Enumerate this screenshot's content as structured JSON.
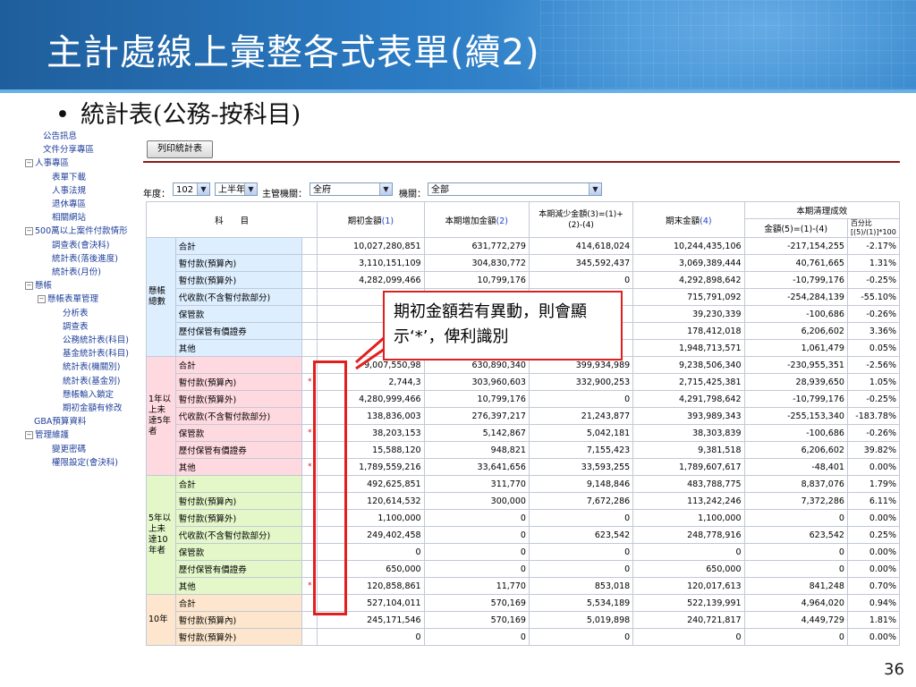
{
  "slide": {
    "title": "主計處線上彙整各式表單(續2)",
    "bullet": "統計表(公務-按科目)",
    "bullet_glyph": "•",
    "page_number": "36",
    "callout": "期初金額若有異動，則會顯示‘*’，俾利識別"
  },
  "sidebar": {
    "items": [
      {
        "label": "公告訊息",
        "toggle": ""
      },
      {
        "label": "文件分享專區",
        "toggle": ""
      },
      {
        "label": "人事專區",
        "toggle": "⊟"
      },
      {
        "label": "表單下載",
        "toggle": ""
      },
      {
        "label": "人事法規",
        "toggle": ""
      },
      {
        "label": "退休專區",
        "toggle": ""
      },
      {
        "label": "相關網站",
        "toggle": ""
      },
      {
        "label": "500萬以上案件付款情形",
        "toggle": "⊟"
      },
      {
        "label": "調查表(會決科)",
        "toggle": ""
      },
      {
        "label": "統計表(落後進度)",
        "toggle": ""
      },
      {
        "label": "統計表(月份)",
        "toggle": ""
      },
      {
        "label": "懸帳",
        "toggle": "⊟"
      },
      {
        "label": "懸帳表單管理",
        "toggle": "⊟"
      },
      {
        "label": "分析表",
        "toggle": ""
      },
      {
        "label": "調查表",
        "toggle": ""
      },
      {
        "label": "公務統計表(科目)",
        "toggle": ""
      },
      {
        "label": "基金統計表(科目)",
        "toggle": ""
      },
      {
        "label": "統計表(機關別)",
        "toggle": ""
      },
      {
        "label": "統計表(基金別)",
        "toggle": ""
      },
      {
        "label": "懸帳輸入鎖定",
        "toggle": ""
      },
      {
        "label": "期初金額有修改",
        "toggle": ""
      },
      {
        "label": "GBA預算資料",
        "toggle": ""
      },
      {
        "label": "管理維護",
        "toggle": "⊟"
      },
      {
        "label": "變更密碼",
        "toggle": ""
      },
      {
        "label": "權限設定(會決科)",
        "toggle": ""
      }
    ]
  },
  "toolbar": {
    "print_label": "列印統計表"
  },
  "filters": {
    "year_label": "年度：",
    "year_value": "102",
    "half_value": "上半年",
    "agency_label": "主管機關：",
    "agency_value": "全府",
    "org_label": "機關：",
    "org_value": "全部",
    "dropdown_glyph": "▼"
  },
  "table": {
    "headers": {
      "subject": "科　　目",
      "opening": "期初金額",
      "opening_num": "(1)",
      "increase": "本期增加金額",
      "increase_num": "(2)",
      "decrease": "本期減少金額(3)=(1)+(2)-(4)",
      "closing": "期末金額",
      "closing_num": "(4)",
      "clearing": "本期清理成效",
      "amount": "金額(5)=(1)-(4)",
      "percent": "百分比[(5)/(1)]*100"
    },
    "groups": [
      {
        "name": "懸帳總數",
        "rows": [
          {
            "item": "合計",
            "star": "",
            "opening": "10,027,280,851",
            "increase": "631,772,279",
            "decrease": "414,618,024",
            "closing": "10,244,435,106",
            "amount": "-217,154,255",
            "pct": "-2.17%"
          },
          {
            "item": "暫付款(預算內)",
            "star": "",
            "opening": "3,110,151,109",
            "increase": "304,830,772",
            "decrease": "345,592,437",
            "closing": "3,069,389,444",
            "amount": "40,761,665",
            "pct": "1.31%"
          },
          {
            "item": "暫付款(預算外)",
            "star": "",
            "opening": "4,282,099,466",
            "increase": "10,799,176",
            "decrease": "0",
            "closing": "4,292,898,642",
            "amount": "-10,799,176",
            "pct": "-0.25%"
          },
          {
            "item": "代收款(不含暫付款部分)",
            "star": "",
            "opening": "461,5",
            "increase": "",
            "decrease": "",
            "closing": "715,791,092",
            "amount": "-254,284,139",
            "pct": "-55.10%"
          },
          {
            "item": "保管款",
            "star": "",
            "opening": "39,1",
            "increase": "",
            "decrease": "",
            "closing": "39,230,339",
            "amount": "-100,686",
            "pct": "-0.26%"
          },
          {
            "item": "歷付保管有價證券",
            "star": "",
            "opening": "184,6",
            "increase": "",
            "decrease": "",
            "closing": "178,412,018",
            "amount": "6,206,602",
            "pct": "3.36%"
          },
          {
            "item": "其他",
            "star": "",
            "opening": "1,949,7",
            "increase": "",
            "decrease": "",
            "closing": "1,948,713,571",
            "amount": "1,061,479",
            "pct": "0.05%"
          }
        ]
      },
      {
        "name": "1年以上未達5年者",
        "rows": [
          {
            "item": "合計",
            "star": "",
            "opening": "9,007,550,98",
            "increase": "630,890,340",
            "decrease": "399,934,989",
            "closing": "9,238,506,340",
            "amount": "-230,955,351",
            "pct": "-2.56%"
          },
          {
            "item": "暫付款(預算內)",
            "star": "*",
            "opening": "2,744,3",
            "increase": "303,960,603",
            "decrease": "332,900,253",
            "closing": "2,715,425,381",
            "amount": "28,939,650",
            "pct": "1.05%"
          },
          {
            "item": "暫付款(預算外)",
            "star": "",
            "opening": "4,280,999,466",
            "increase": "10,799,176",
            "decrease": "0",
            "closing": "4,291,798,642",
            "amount": "-10,799,176",
            "pct": "-0.25%"
          },
          {
            "item": "代收款(不含暫付款部分)",
            "star": "",
            "opening": "138,836,003",
            "increase": "276,397,217",
            "decrease": "21,243,877",
            "closing": "393,989,343",
            "amount": "-255,153,340",
            "pct": "-183.78%"
          },
          {
            "item": "保管款",
            "star": "*",
            "opening": "38,203,153",
            "increase": "5,142,867",
            "decrease": "5,042,181",
            "closing": "38,303,839",
            "amount": "-100,686",
            "pct": "-0.26%"
          },
          {
            "item": "歷付保管有價證券",
            "star": "",
            "opening": "15,588,120",
            "increase": "948,821",
            "decrease": "7,155,423",
            "closing": "9,381,518",
            "amount": "6,206,602",
            "pct": "39.82%"
          },
          {
            "item": "其他",
            "star": "*",
            "opening": "1,789,559,216",
            "increase": "33,641,656",
            "decrease": "33,593,255",
            "closing": "1,789,607,617",
            "amount": "-48,401",
            "pct": "0.00%"
          }
        ]
      },
      {
        "name": "5年以上未達10年者",
        "rows": [
          {
            "item": "合計",
            "star": "",
            "opening": "492,625,851",
            "increase": "311,770",
            "decrease": "9,148,846",
            "closing": "483,788,775",
            "amount": "8,837,076",
            "pct": "1.79%"
          },
          {
            "item": "暫付款(預算內)",
            "star": "",
            "opening": "120,614,532",
            "increase": "300,000",
            "decrease": "7,672,286",
            "closing": "113,242,246",
            "amount": "7,372,286",
            "pct": "6.11%"
          },
          {
            "item": "暫付款(預算外)",
            "star": "",
            "opening": "1,100,000",
            "increase": "0",
            "decrease": "0",
            "closing": "1,100,000",
            "amount": "0",
            "pct": "0.00%"
          },
          {
            "item": "代收款(不含暫付款部分)",
            "star": "",
            "opening": "249,402,458",
            "increase": "0",
            "decrease": "623,542",
            "closing": "248,778,916",
            "amount": "623,542",
            "pct": "0.25%"
          },
          {
            "item": "保管款",
            "star": "",
            "opening": "0",
            "increase": "0",
            "decrease": "0",
            "closing": "0",
            "amount": "0",
            "pct": "0.00%"
          },
          {
            "item": "歷付保管有價證券",
            "star": "",
            "opening": "650,000",
            "increase": "0",
            "decrease": "0",
            "closing": "650,000",
            "amount": "0",
            "pct": "0.00%"
          },
          {
            "item": "其他",
            "star": "*",
            "opening": "120,858,861",
            "increase": "11,770",
            "decrease": "853,018",
            "closing": "120,017,613",
            "amount": "841,248",
            "pct": "0.70%"
          }
        ]
      },
      {
        "name": "10年",
        "rows": [
          {
            "item": "合計",
            "star": "",
            "opening": "527,104,011",
            "increase": "570,169",
            "decrease": "5,534,189",
            "closing": "522,139,991",
            "amount": "4,964,020",
            "pct": "0.94%"
          },
          {
            "item": "暫付款(預算內)",
            "star": "",
            "opening": "245,171,546",
            "increase": "570,169",
            "decrease": "5,019,898",
            "closing": "240,721,817",
            "amount": "4,449,729",
            "pct": "1.81%"
          },
          {
            "item": "暫付款(預算外)",
            "star": "",
            "opening": "0",
            "increase": "0",
            "decrease": "0",
            "closing": "0",
            "amount": "0",
            "pct": "0.00%"
          }
        ]
      }
    ]
  }
}
